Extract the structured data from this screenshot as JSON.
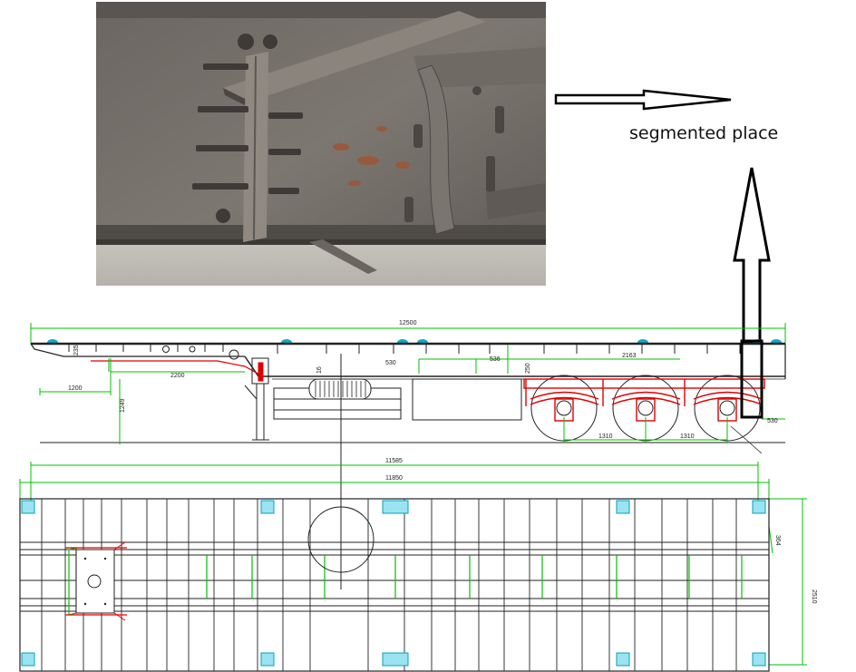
{
  "annotation": {
    "label": "segmented place"
  },
  "side_view": {
    "dims": {
      "overall_length": "12500",
      "gooseneck_height": "1249",
      "kingpin_offset": "1200",
      "gooseneck_length": "2200",
      "axle_spacing_1": "1310",
      "axle_spacing_2": "1310",
      "rear_overhang": "530",
      "span_a": "2163",
      "dim_530": "530",
      "dim_536": "536",
      "dim_16": "16",
      "dim_250": "250",
      "dim_235": "235"
    }
  },
  "plan_view": {
    "dims": {
      "length_outer": "11850",
      "length_inner": "11585",
      "width": "2510",
      "beam_spacing": "364"
    }
  },
  "colors": {
    "frame": "#222222",
    "dimension": "#00c000",
    "suspension": "#e00000",
    "twistlock": "#00b0d0"
  }
}
